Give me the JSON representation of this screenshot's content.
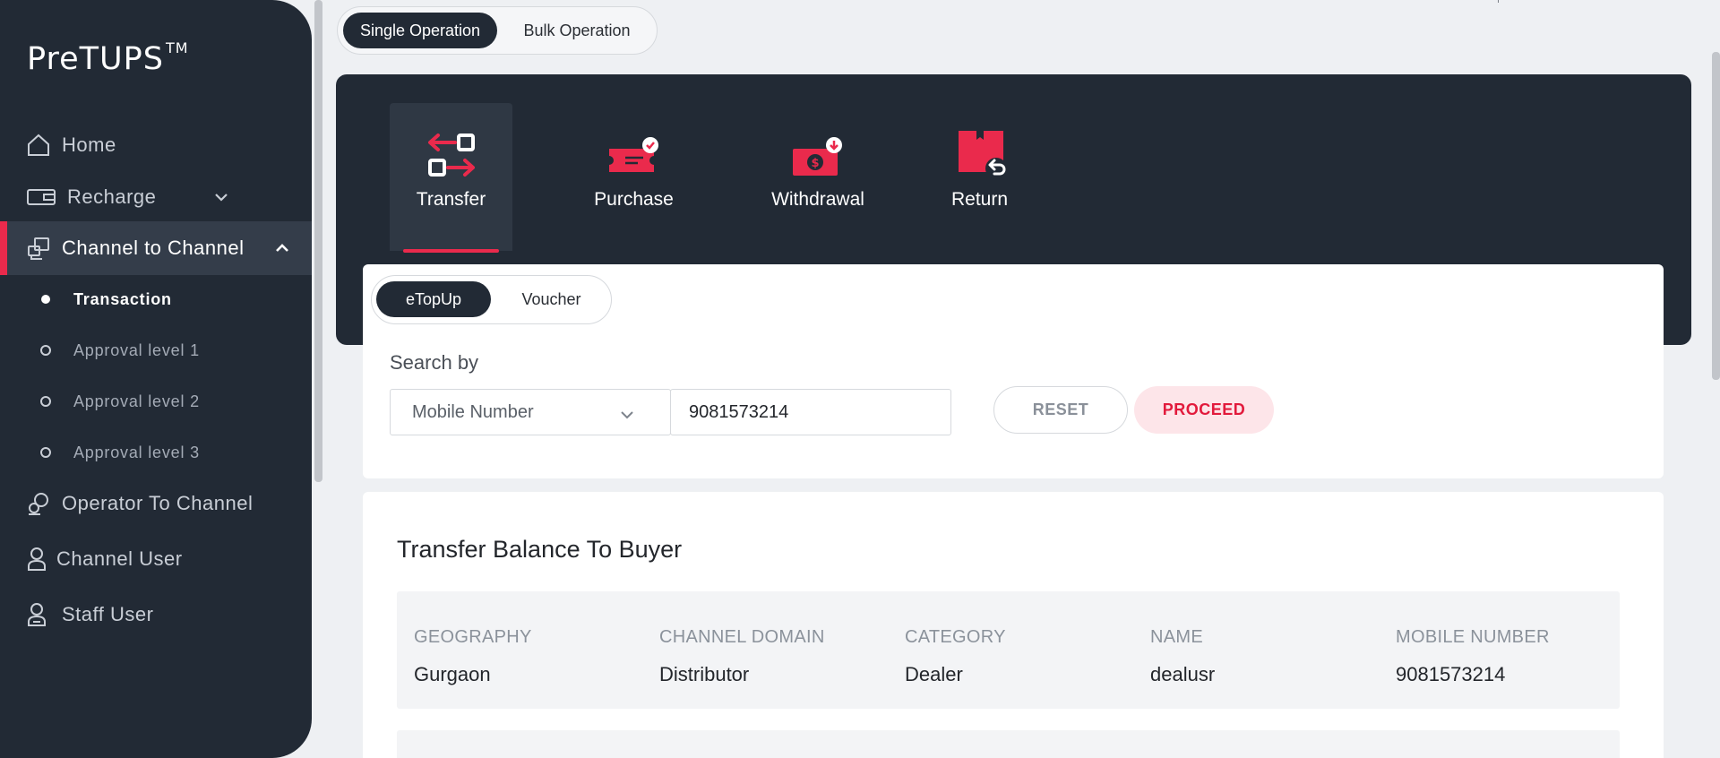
{
  "sidebar": {
    "brand": "PreTUPS",
    "brand_tm": "TM",
    "items": [
      {
        "label": "Home",
        "icon": "home-icon"
      },
      {
        "label": "Recharge",
        "icon": "recharge-icon"
      },
      {
        "label": "Channel to Channel",
        "icon": "channel-icon"
      },
      {
        "label": "Operator To Channel",
        "icon": "operator-icon"
      },
      {
        "label": "Channel User",
        "icon": "user-icon"
      },
      {
        "label": "Staff User",
        "icon": "staff-icon"
      }
    ],
    "sub_items": [
      {
        "label": "Transaction"
      },
      {
        "label": "Approval level 1"
      },
      {
        "label": "Approval level 2"
      },
      {
        "label": "Approval level 3"
      }
    ]
  },
  "operation_toggle": {
    "single": "Single Operation",
    "bulk": "Bulk Operation"
  },
  "transaction_tabs": [
    {
      "label": "Transfer",
      "icon": "transfer-icon"
    },
    {
      "label": "Purchase",
      "icon": "purchase-icon"
    },
    {
      "label": "Withdrawal",
      "icon": "withdrawal-icon"
    },
    {
      "label": "Return",
      "icon": "return-icon"
    }
  ],
  "type_toggle": {
    "etopup": "eTopUp",
    "voucher": "Voucher"
  },
  "search": {
    "label": "Search by",
    "select_value": "Mobile Number",
    "input_value": "9081573214",
    "reset_label": "RESET",
    "proceed_label": "PROCEED"
  },
  "buyer": {
    "title": "Transfer Balance To Buyer",
    "columns": [
      {
        "header": "GEOGRAPHY",
        "value": "Gurgaon"
      },
      {
        "header": "CHANNEL DOMAIN",
        "value": "Distributor"
      },
      {
        "header": "CATEGORY",
        "value": "Dealer"
      },
      {
        "header": "NAME",
        "value": "dealusr"
      },
      {
        "header": "MOBILE NUMBER",
        "value": "9081573214"
      }
    ]
  },
  "colors": {
    "accent": "#ea2a4c",
    "sidebar_bg": "#222a35",
    "proceed_bg": "#fde5e9"
  }
}
